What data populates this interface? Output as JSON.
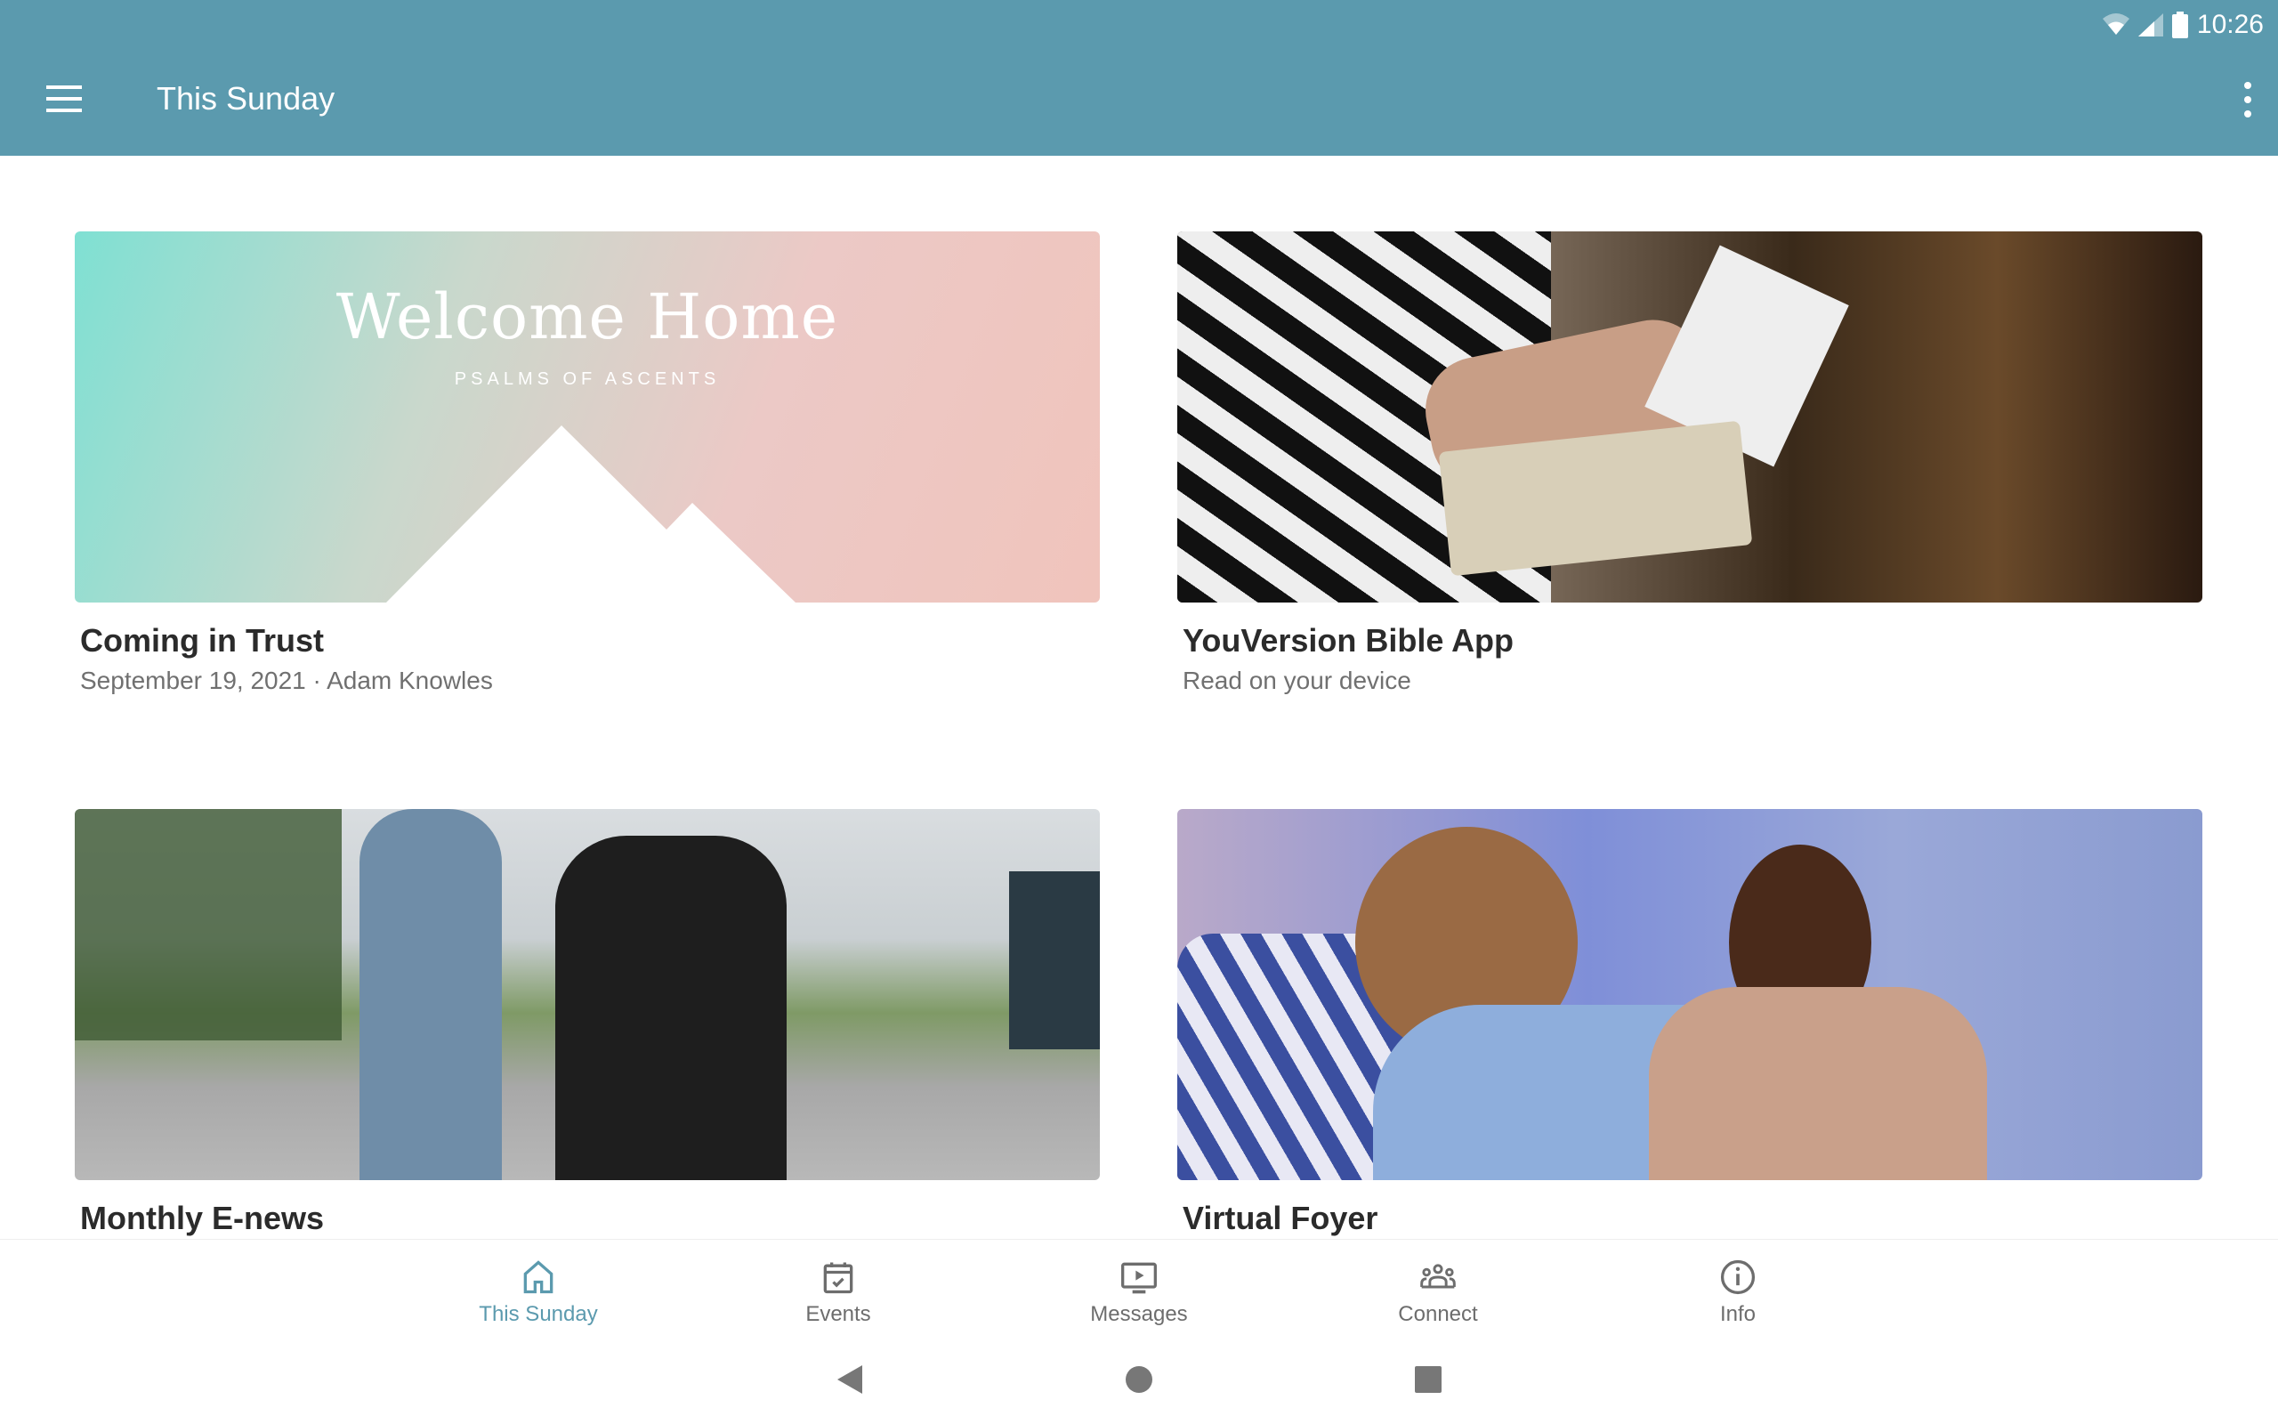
{
  "status_bar": {
    "time": "10:26",
    "icons": [
      "wifi-icon",
      "signal-icon",
      "battery-icon"
    ]
  },
  "app_bar": {
    "title": "This Sunday",
    "menu_icon": "hamburger-icon",
    "overflow_icon": "more-vert-icon"
  },
  "cards": [
    {
      "title": "Coming in Trust",
      "subtitle": "September 19, 2021 · Adam Knowles",
      "image_heading": "Welcome Home",
      "image_subheading": "PSALMS OF ASCENTS"
    },
    {
      "title": "YouVersion Bible App",
      "subtitle": "Read on your device",
      "image_desc": "Person holding a paper and an open Bible"
    },
    {
      "title": "Monthly E-news",
      "subtitle": "",
      "image_desc": "Two women singing outdoors with microphones"
    },
    {
      "title": "Virtual Foyer",
      "subtitle": "",
      "image_desc": "People talking and smiling in a gathering"
    }
  ],
  "bottom_nav": {
    "active_color": "#5b9aae",
    "items": [
      {
        "label": "This Sunday",
        "icon": "home-icon",
        "active": true
      },
      {
        "label": "Events",
        "icon": "calendar-check-icon",
        "active": false
      },
      {
        "label": "Messages",
        "icon": "video-icon",
        "active": false
      },
      {
        "label": "Connect",
        "icon": "people-icon",
        "active": false
      },
      {
        "label": "Info",
        "icon": "info-icon",
        "active": false
      }
    ]
  },
  "system_nav": [
    "back",
    "home",
    "recents"
  ]
}
